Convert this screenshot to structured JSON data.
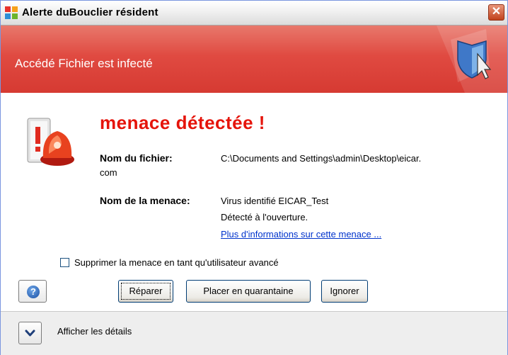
{
  "window": {
    "title": "Alerte duBouclier résident",
    "close_glyph": "✕"
  },
  "banner": {
    "text": "Accédé Fichier est infecté",
    "icon": "shield-cursor-icon"
  },
  "alert": {
    "headline": "menace détectée !",
    "icon": "alarm-siren-icon",
    "file_label": "Nom du fichier:",
    "file_value_line1": "C:\\Documents and Settings\\admin\\Desktop\\eicar.",
    "file_value_line2": "com",
    "threat_label": "Nom de la menace:",
    "threat_value": "Virus identifié EICAR_Test",
    "detected_text": "Détecté à l'ouverture.",
    "more_info_link": "Plus d'informations sur cette menace ..."
  },
  "options": {
    "advanced_checkbox_label": "Supprimer la menace en tant qu'utilisateur avancé",
    "advanced_checked": false
  },
  "buttons": {
    "help_icon": "help-icon",
    "help_glyph": "?",
    "repair": "Réparer",
    "quarantine": "Placer en quarantaine",
    "ignore": "Ignorer"
  },
  "footer": {
    "details_label": "Afficher les détails",
    "details_icon": "chevron-down-icon"
  },
  "colors": {
    "banner_red": "#e04a41",
    "headline_red": "#e5140b",
    "link_blue": "#0033cc"
  }
}
